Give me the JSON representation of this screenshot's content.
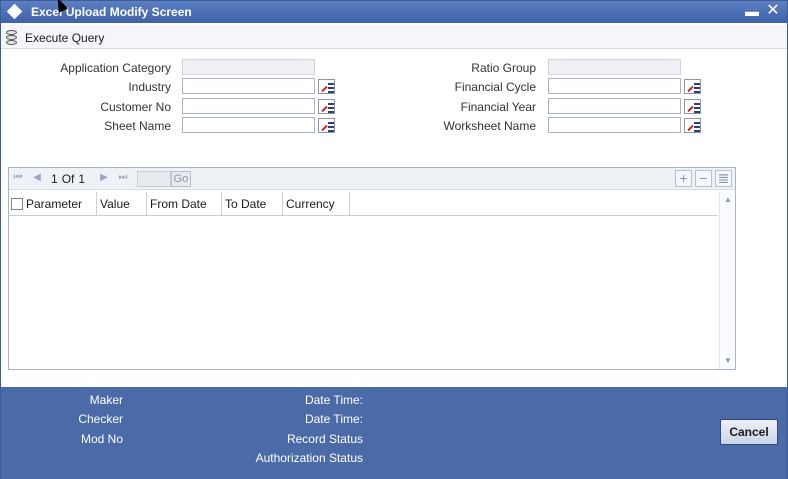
{
  "window": {
    "title": "Excel Upload Modify Screen",
    "minimize_label": "▬",
    "close_label": "✕"
  },
  "toolbar": {
    "execute_query_label": "Execute Query"
  },
  "form": {
    "application_category": {
      "label": "Application Category",
      "value": ""
    },
    "industry": {
      "label": "Industry",
      "value": ""
    },
    "customer_no": {
      "label": "Customer No",
      "value": ""
    },
    "sheet_name": {
      "label": "Sheet Name",
      "value": ""
    },
    "ratio_group": {
      "label": "Ratio Group",
      "value": ""
    },
    "financial_cycle": {
      "label": "Financial Cycle",
      "value": ""
    },
    "financial_year": {
      "label": "Financial Year",
      "value": ""
    },
    "worksheet_name": {
      "label": "Worksheet Name",
      "value": ""
    }
  },
  "grid": {
    "current_page": "1",
    "of_label": "Of",
    "total_pages": "1",
    "go_label": "Go",
    "columns": [
      "Parameter",
      "Value",
      "From Date",
      "To Date",
      "Currency"
    ],
    "rows": []
  },
  "footer": {
    "maker_label": "Maker",
    "checker_label": "Checker",
    "mod_no_label": "Mod No",
    "date_time_label_1": "Date Time:",
    "date_time_label_2": "Date Time:",
    "record_status_label": "Record Status",
    "authorization_status_label": "Authorization Status",
    "cancel_label": "Cancel"
  },
  "colors": {
    "title_bar": "#4a6db2",
    "footer": "#4b6aa8",
    "field_border": "#a9b3c6"
  }
}
